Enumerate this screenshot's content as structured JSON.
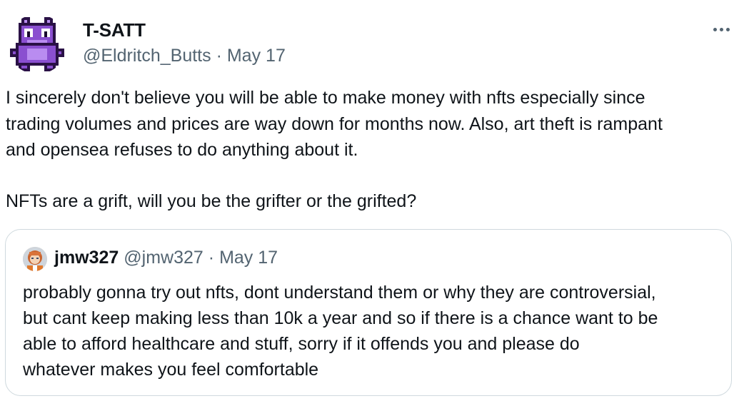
{
  "tweet": {
    "display_name": "T-SATT",
    "handle": "@Eldritch_Butts",
    "separator": "·",
    "date": "May 17",
    "more_icon": "more-horizontal-icon",
    "avatar": "pixel-art-purple-creature",
    "text_lines": [
      "I sincerely don't believe you will be able to make money with nfts especially since",
      "trading volumes and prices are way down for months now. Also, art theft is rampant",
      "and opensea refuses to do anything about it.",
      "NFTs are a grift, will you be the grifter or the grifted?"
    ]
  },
  "quote": {
    "display_name": "jmw327",
    "handle": "@jmw327",
    "separator": "·",
    "date": "May 17",
    "avatar": "anime-character-avatar",
    "text_lines": [
      "probably gonna try out nfts, dont understand them or why they are controversial,",
      "but cant keep making less than 10k a year and so if there is a chance want to be",
      "able to afford healthcare and stuff, sorry if it offends you and please do",
      "whatever makes you feel comfortable"
    ]
  },
  "colors": {
    "text_primary": "#0f1419",
    "text_secondary": "#536471",
    "border": "#cfd9de",
    "avatar_purple": "#8a4fd0"
  }
}
